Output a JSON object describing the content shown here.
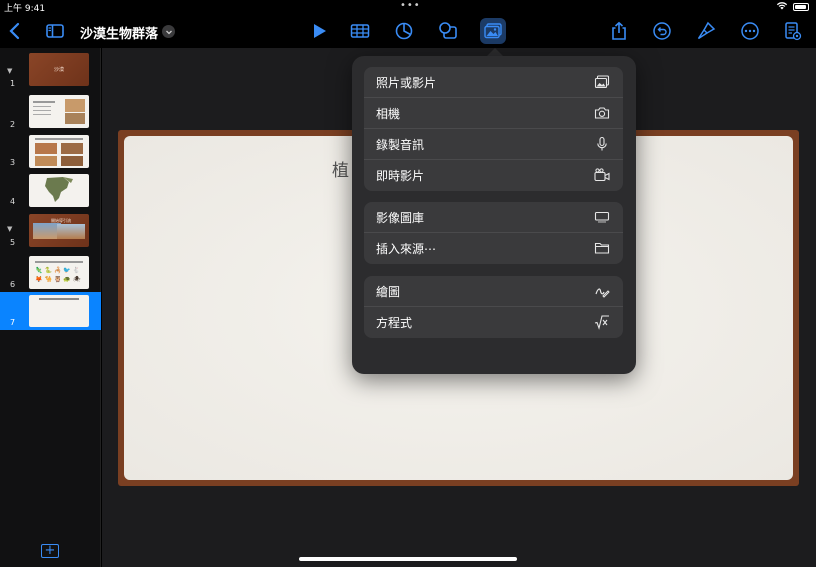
{
  "status": {
    "time": "上午 9:41",
    "dots": "•••"
  },
  "toolbar": {
    "title": "沙漠生物群落",
    "icons": [
      "back-icon",
      "sidebar-icon",
      "play-icon",
      "table-icon",
      "chart-icon",
      "shape-icon",
      "media-icon",
      "share-icon",
      "undo-icon",
      "format-brush-icon",
      "more-icon",
      "document-icon"
    ]
  },
  "sidebar": {
    "slides": [
      {
        "num": "1",
        "label": "沙漠",
        "style": "brown",
        "collapsible": true
      },
      {
        "num": "2",
        "style": "white"
      },
      {
        "num": "3",
        "style": "white"
      },
      {
        "num": "4",
        "style": "white"
      },
      {
        "num": "5",
        "label": "開始導引流",
        "style": "brown",
        "collapsible": true
      },
      {
        "num": "6",
        "style": "white"
      },
      {
        "num": "7",
        "style": "white",
        "selected": true
      }
    ]
  },
  "slide": {
    "title": "植"
  },
  "insert_menu": {
    "groups": [
      [
        {
          "label": "照片或影片",
          "icon": "photo-icon"
        },
        {
          "label": "相機",
          "icon": "camera-icon"
        },
        {
          "label": "錄製音訊",
          "icon": "microphone-icon"
        },
        {
          "label": "即時影片",
          "icon": "live-video-icon"
        }
      ],
      [
        {
          "label": "影像圖庫",
          "icon": "image-gallery-icon"
        },
        {
          "label": "插入來源⋯",
          "icon": "folder-icon"
        }
      ],
      [
        {
          "label": "繪圖",
          "icon": "drawing-icon"
        },
        {
          "label": "方程式",
          "icon": "equation-icon"
        }
      ]
    ]
  },
  "colors": {
    "accent": "#3a8cf5",
    "selected": "#0a84ff",
    "popover": "#2c2c2e",
    "slide_frame": "#7a3f22"
  }
}
